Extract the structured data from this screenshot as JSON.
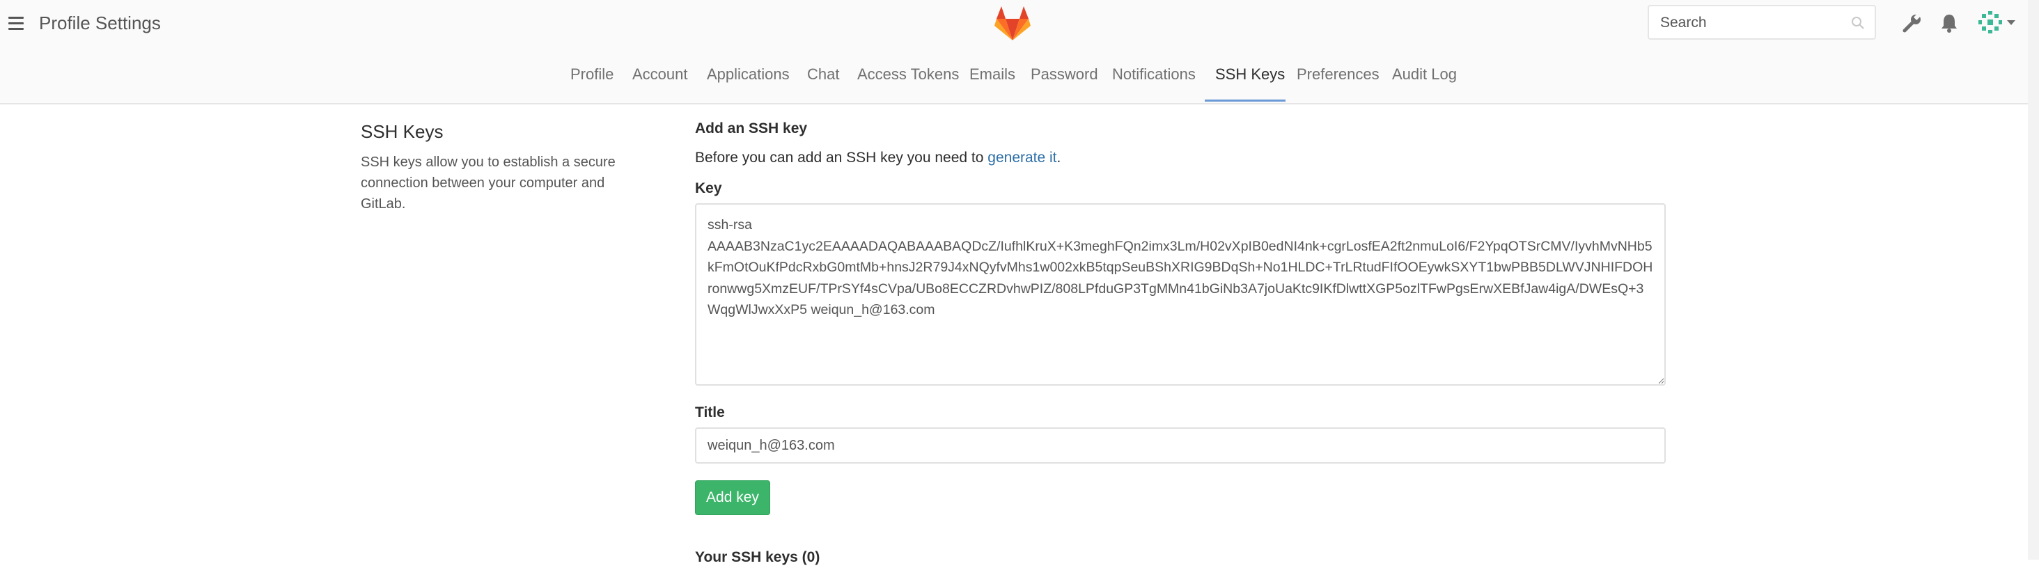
{
  "header": {
    "title": "Profile Settings",
    "search_placeholder": "Search",
    "icons": [
      "menu-icon",
      "gitlab-logo",
      "search-icon",
      "wrench-icon",
      "bell-icon",
      "avatar",
      "chevron-down-icon"
    ]
  },
  "nav": {
    "tabs": [
      {
        "label": "Profile"
      },
      {
        "label": "Account"
      },
      {
        "label": "Applications"
      },
      {
        "label": "Chat"
      },
      {
        "label": "Access Tokens"
      },
      {
        "label": "Emails"
      },
      {
        "label": "Password"
      },
      {
        "label": "Notifications"
      },
      {
        "label": "SSH Keys",
        "active": true
      },
      {
        "label": "Preferences"
      },
      {
        "label": "Audit Log"
      }
    ]
  },
  "sidebar": {
    "title": "SSH Keys",
    "description": "SSH keys allow you to establish a secure connection between your computer and GitLab."
  },
  "form": {
    "heading": "Add an SSH key",
    "intro_text": "Before you can add an SSH key you need to ",
    "intro_link": "generate it",
    "intro_suffix": ".",
    "key_label": "Key",
    "key_value": "ssh-rsa\nAAAAB3NzaC1yc2EAAAADAQABAAABAQDcZ/IufhlKruX+K3meghFQn2imx3Lm/H02vXpIB0edNI4nk+cgrLosfEA2ft2nmuLoI6/F2YpqOTSrCMV/IyvhMvNHb5kFmOtOuKfPdcRxbG0mtMb+hnsJ2R79J4xNQyfvMhs1w002xkB5tqpSeuBShXRIG9BDqSh+No1HLDC+TrLRtudFIfOOEywkSXYT1bwPBB5DLWVJNHIFDOHronwwg5XmzEUF/TPrSYf4sCVpa/UBo8ECCZRDvhwPIZ/808LPfduGP3TgMMn41bGiNb3A7joUaKtc9IKfDlwttXGP5ozlTFwPgsErwXEBfJaw4igA/DWEsQ+3WqgWlJwxXxP5 weiqun_h@163.com",
    "title_label": "Title",
    "title_value": "weiqun_h@163.com",
    "add_button": "Add key",
    "your_keys_label": "Your SSH keys (0)"
  },
  "colors": {
    "accent_blue": "#6b9ad6",
    "link": "#2e6fa8",
    "button_green": "#3cb56a"
  }
}
